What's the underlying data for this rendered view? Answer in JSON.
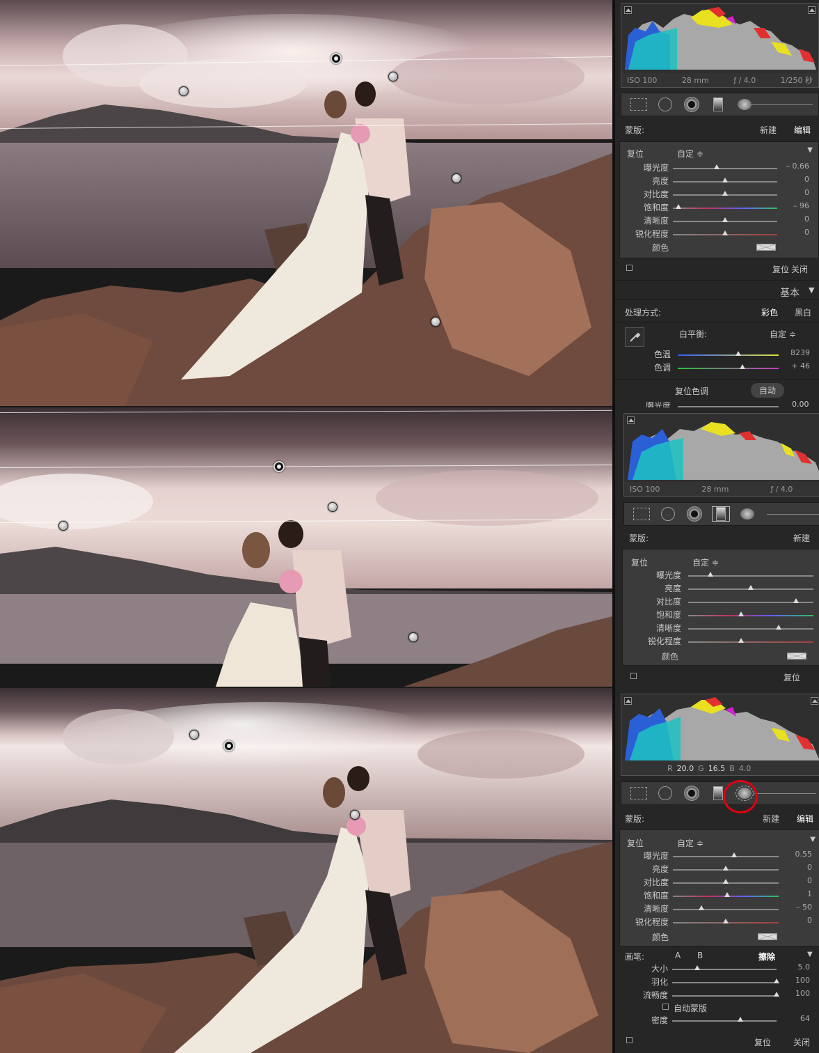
{
  "colors": {
    "accent_red": "#e00010",
    "panel_bg": "#262626",
    "box_bg": "#3b3b3b"
  },
  "shot1": {
    "histogram": {
      "iso": "ISO 100",
      "focal": "28 mm",
      "aperture": "ƒ / 4.0",
      "shutter": "1/250 秒"
    },
    "mask": {
      "label": "蒙版:",
      "new": "新建",
      "edit": "编辑"
    },
    "effect": {
      "reset": "复位",
      "preset": "自定 ≑",
      "collapse": "▼"
    },
    "sliders": [
      {
        "label": "曝光度",
        "value": "– 0.66",
        "pos": 0.42
      },
      {
        "label": "亮度",
        "value": "0",
        "pos": 0.5
      },
      {
        "label": "对比度",
        "value": "0",
        "pos": 0.5
      },
      {
        "label": "饱和度",
        "value": "– 96",
        "pos": 0.05
      },
      {
        "label": "清晰度",
        "value": "0",
        "pos": 0.5
      },
      {
        "label": "锐化程度",
        "value": "0",
        "pos": 0.5
      }
    ],
    "color_label": "颜色",
    "bottom": {
      "reset": "复位",
      "close": "关闭"
    },
    "basic": {
      "title": "基本",
      "arrow": "▼",
      "treatment_label": "处理方式:",
      "color": "彩色",
      "bw": "黑白",
      "wb_label": "白平衡:",
      "wb_value": "自定 ≑",
      "temp": {
        "label": "色温",
        "value": "8239",
        "pos": 0.6
      },
      "tint": {
        "label": "色调",
        "value": "+ 46",
        "pos": 0.64
      },
      "tone_label": "复位色调",
      "auto": "自动",
      "exposure_partial": "曝光度",
      "exposure_value": "0.00"
    }
  },
  "shot2": {
    "histogram": {
      "iso": "ISO 100",
      "focal": "28 mm",
      "aperture": "ƒ / 4.0"
    },
    "mask": {
      "label": "蒙版:",
      "new": "新建"
    },
    "effect": {
      "reset": "复位",
      "preset": "自定 ≑"
    },
    "sliders": [
      {
        "label": "曝光度",
        "pos": 0.18
      },
      {
        "label": "亮度",
        "pos": 0.5
      },
      {
        "label": "对比度",
        "pos": 0.86
      },
      {
        "label": "饱和度",
        "pos": 0.42
      },
      {
        "label": "清晰度",
        "pos": 0.72
      },
      {
        "label": "锐化程度",
        "pos": 0.42
      }
    ],
    "color_label": "颜色",
    "bottom": {
      "reset": "复位"
    }
  },
  "shot3": {
    "histogram": {
      "r_label": "R",
      "r": "20.0",
      "g_label": "G",
      "g": "16.5",
      "b_label": "B",
      "b": "4.0"
    },
    "mask": {
      "label": "蒙版:",
      "new": "新建",
      "edit": "编辑"
    },
    "effect": {
      "reset": "复位",
      "preset": "自定 ≑",
      "collapse": "▼"
    },
    "sliders": [
      {
        "label": "曝光度",
        "value": "0.55",
        "pos": 0.58
      },
      {
        "label": "亮度",
        "value": "0",
        "pos": 0.5
      },
      {
        "label": "对比度",
        "value": "0",
        "pos": 0.5
      },
      {
        "label": "饱和度",
        "value": "1",
        "pos": 0.51
      },
      {
        "label": "清晰度",
        "value": "– 50",
        "pos": 0.27
      },
      {
        "label": "锐化程度",
        "value": "0",
        "pos": 0.5
      }
    ],
    "color_label": "颜色",
    "brush": {
      "label": "画笔:",
      "a": "A",
      "b": "B",
      "erase": "擦除",
      "arrow": "▼",
      "size": {
        "label": "大小",
        "value": "5.0",
        "pos": 0.24
      },
      "feather": {
        "label": "羽化",
        "value": "100",
        "pos": 1.0
      },
      "flow": {
        "label": "流畅度",
        "value": "100",
        "pos": 1.0
      },
      "automask": "自动蒙版",
      "density": {
        "label": "密度",
        "value": "64",
        "pos": 0.65
      }
    },
    "bottom": {
      "reset": "复位",
      "close": "关闭"
    }
  }
}
